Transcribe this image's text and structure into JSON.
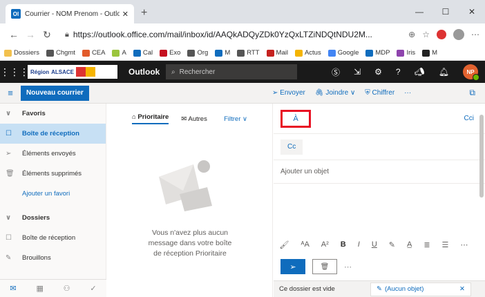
{
  "browser": {
    "tab_title": "Courrier - NOM Prenom - Outlo…",
    "tab_favicon": "Ol",
    "url_host": "outlook.office.com",
    "url_prefix": "https://",
    "url_path": "/mail/inbox/id/AAQkADQyZDk0YzQxLTZiNDQtNDU2M...",
    "bookmarks": [
      {
        "label": "Dossiers",
        "color": "#f2c14e"
      },
      {
        "label": "Chgmt",
        "color": "#555555"
      },
      {
        "label": "CEA",
        "color": "#e25b2b"
      },
      {
        "label": "A",
        "color": "#9bc53d"
      },
      {
        "label": "Cal",
        "color": "#0f6cbd"
      },
      {
        "label": "Exo",
        "color": "#c50f1f"
      },
      {
        "label": "Org",
        "color": "#555555"
      },
      {
        "label": "M",
        "color": "#0f6cbd"
      },
      {
        "label": "RTT",
        "color": "#555555"
      },
      {
        "label": "Mail",
        "color": "#c5221f"
      },
      {
        "label": "Actus",
        "color": "#f4b400"
      },
      {
        "label": "Google",
        "color": "#4285f4"
      },
      {
        "label": "MDP",
        "color": "#0f6cbd"
      },
      {
        "label": "Iris",
        "color": "#8e44ad"
      },
      {
        "label": "M",
        "color": "#222222"
      }
    ]
  },
  "outlook": {
    "org_name": "ALSACE",
    "org_prefix": "Région",
    "app_title": "Outlook",
    "search_placeholder": "Rechercher",
    "avatar_initials": "NP"
  },
  "command": {
    "new_mail": "Nouveau courrier",
    "send": "Envoyer",
    "attach": "Joindre",
    "encrypt": "Chiffrer",
    "more": "···"
  },
  "nav": {
    "favorites": "Favoris",
    "inbox": "Boîte de réception",
    "sent": "Éléments envoyés",
    "deleted": "Éléments supprimés",
    "add_favorite": "Ajouter un favori",
    "folders": "Dossiers",
    "folder_inbox": "Boîte de réception",
    "drafts": "Brouillons"
  },
  "list": {
    "focused": "Prioritaire",
    "other": "Autres",
    "filter": "Filtrer",
    "empty_line1": "Vous n'avez plus aucun",
    "empty_line2": "message dans votre boîte",
    "empty_line3": "de réception Prioritaire"
  },
  "compose": {
    "to": "À",
    "cci": "Cci",
    "cc": "Cc",
    "subject_placeholder": "Ajouter un objet"
  },
  "status": {
    "folder_empty": "Ce dossier est vide",
    "draft_tab": "(Aucun objet)"
  }
}
